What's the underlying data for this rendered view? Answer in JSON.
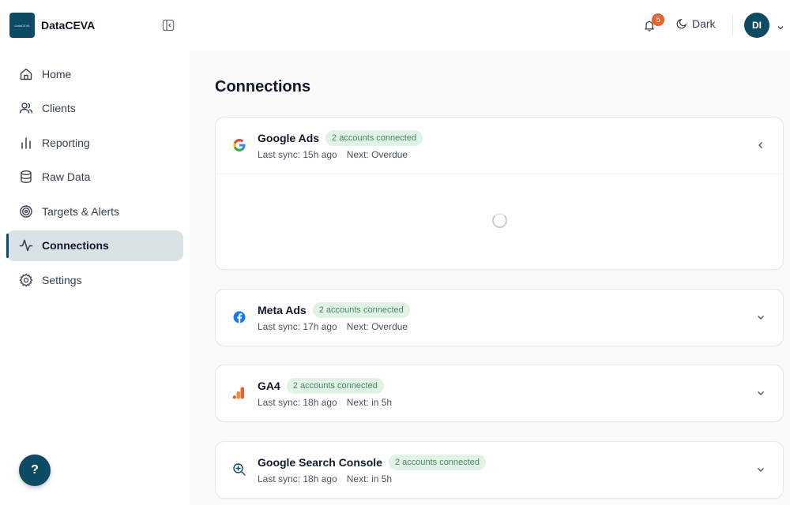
{
  "brand": {
    "name": "DataCEVA",
    "logo_text": "DataCEVA"
  },
  "nav": {
    "items": [
      {
        "label": "Home",
        "icon": "home-icon"
      },
      {
        "label": "Clients",
        "icon": "users-icon"
      },
      {
        "label": "Reporting",
        "icon": "bar-chart-icon"
      },
      {
        "label": "Raw Data",
        "icon": "database-icon"
      },
      {
        "label": "Targets & Alerts",
        "icon": "target-icon"
      },
      {
        "label": "Connections",
        "icon": "activity-icon",
        "active": true
      },
      {
        "label": "Settings",
        "icon": "gear-icon"
      }
    ]
  },
  "help": {
    "label": "?"
  },
  "topbar": {
    "notification_count": "5",
    "theme_label": "Dark",
    "avatar_initials": "DI"
  },
  "page": {
    "title": "Connections"
  },
  "connections": [
    {
      "name": "Google Ads",
      "status": "2 accounts connected",
      "last_sync": "Last sync: 15h ago",
      "next": "Next: Overdue",
      "expanded": true,
      "icon": "google-icon"
    },
    {
      "name": "Meta Ads",
      "status": "2 accounts connected",
      "last_sync": "Last sync: 17h ago",
      "next": "Next: Overdue",
      "expanded": false,
      "icon": "facebook-icon"
    },
    {
      "name": "GA4",
      "status": "2 accounts connected",
      "last_sync": "Last sync: 18h ago",
      "next": "Next: in 5h",
      "expanded": false,
      "icon": "analytics-icon"
    },
    {
      "name": "Google Search Console",
      "status": "2 accounts connected",
      "last_sync": "Last sync: 18h ago",
      "next": "Next: in 5h",
      "expanded": false,
      "icon": "search-console-icon"
    }
  ],
  "colors": {
    "brand": "#0d4a63",
    "badge": "#e8622c",
    "pill_bg": "#e3f2e6",
    "pill_text": "#3f8f55",
    "active_nav_bg": "#d9e3e6"
  }
}
